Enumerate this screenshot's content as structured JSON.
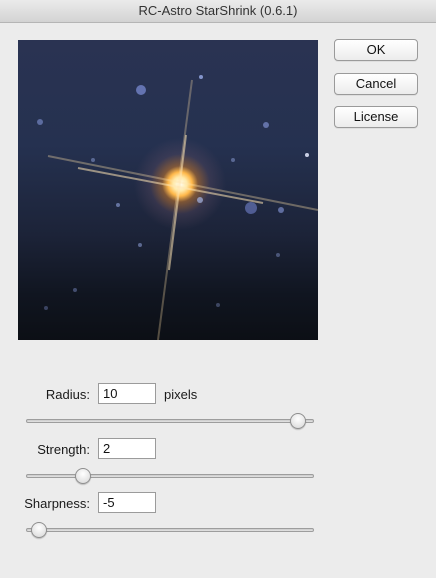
{
  "window": {
    "title": "RC-Astro StarShrink (0.6.1)"
  },
  "buttons": {
    "ok": "OK",
    "cancel": "Cancel",
    "license": "License"
  },
  "controls": {
    "radius": {
      "label": "Radius:",
      "value": "10",
      "unit": "pixels",
      "slider_fraction": 0.97
    },
    "strength": {
      "label": "Strength:",
      "value": "2",
      "slider_fraction": 0.18
    },
    "sharpness": {
      "label": "Sharpness:",
      "value": "-5",
      "slider_fraction": 0.02
    }
  }
}
